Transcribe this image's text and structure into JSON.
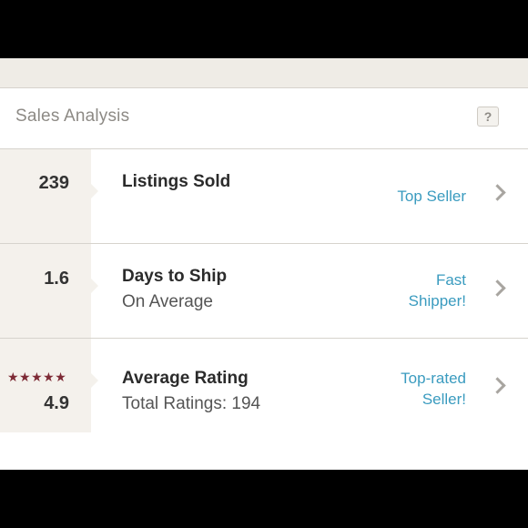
{
  "panel": {
    "title": "Sales Analysis",
    "help_label": "?"
  },
  "rows": [
    {
      "value": "239",
      "title": "Listings Sold",
      "subtitle": "",
      "badge": [
        "Top Seller"
      ]
    },
    {
      "value": "1.6",
      "title": "Days to Ship",
      "subtitle": "On Average",
      "badge": [
        "Fast",
        "Shipper!"
      ]
    },
    {
      "value": "4.9",
      "title": "Average Rating",
      "subtitle": "Total Ratings: 194",
      "badge": [
        "Top-rated",
        "Seller!"
      ],
      "stars": "★★★★★",
      "stars_filled": 5,
      "stars_max": 5
    }
  ],
  "colors": {
    "link": "#3a9bbf",
    "star": "#7d2a35",
    "metric_bg": "#f4f1ec"
  },
  "icons": {
    "help": "question-icon",
    "chevron": "chevron-right-icon",
    "star": "star-icon"
  }
}
